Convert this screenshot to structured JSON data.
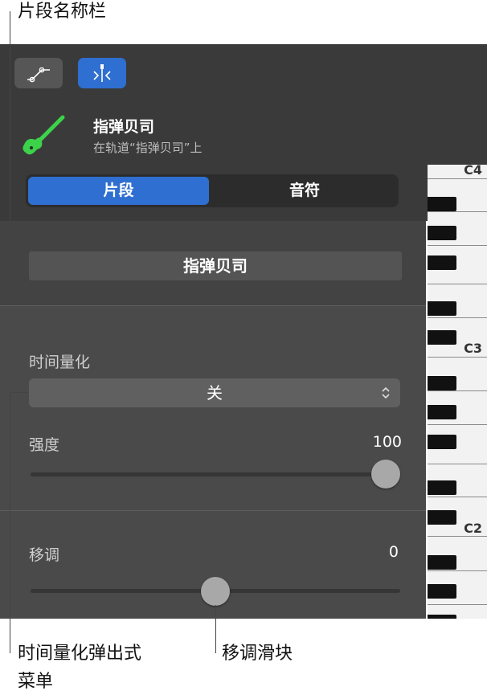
{
  "callouts": {
    "region_name_bar": "片段名称栏",
    "quantize_popup": "时间量化弹出式",
    "quantize_popup_line2": "菜单",
    "transpose_slider": "移调滑块"
  },
  "toolbar": {
    "automation_icon": "automation-curve-icon",
    "catch_icon": "catch-playhead-icon"
  },
  "header": {
    "region_name": "指弹贝司",
    "track_text": "在轨道“指弹贝司”上",
    "instrument_icon": "electric-bass-icon"
  },
  "tabs": [
    {
      "label": "片段",
      "selected": true
    },
    {
      "label": "音符",
      "selected": false
    }
  ],
  "name_field": {
    "value": "指弹贝司"
  },
  "quantize": {
    "label": "时间量化",
    "value": "关"
  },
  "strength": {
    "label": "强度",
    "value": "100",
    "level": 1.0
  },
  "transpose": {
    "label": "移调",
    "value": "0",
    "level": 0.5
  },
  "piano": {
    "labels": [
      "C4",
      "C3",
      "C2"
    ]
  },
  "colors": {
    "accent": "#2f6fd1",
    "instrument": "#3cd24a"
  }
}
